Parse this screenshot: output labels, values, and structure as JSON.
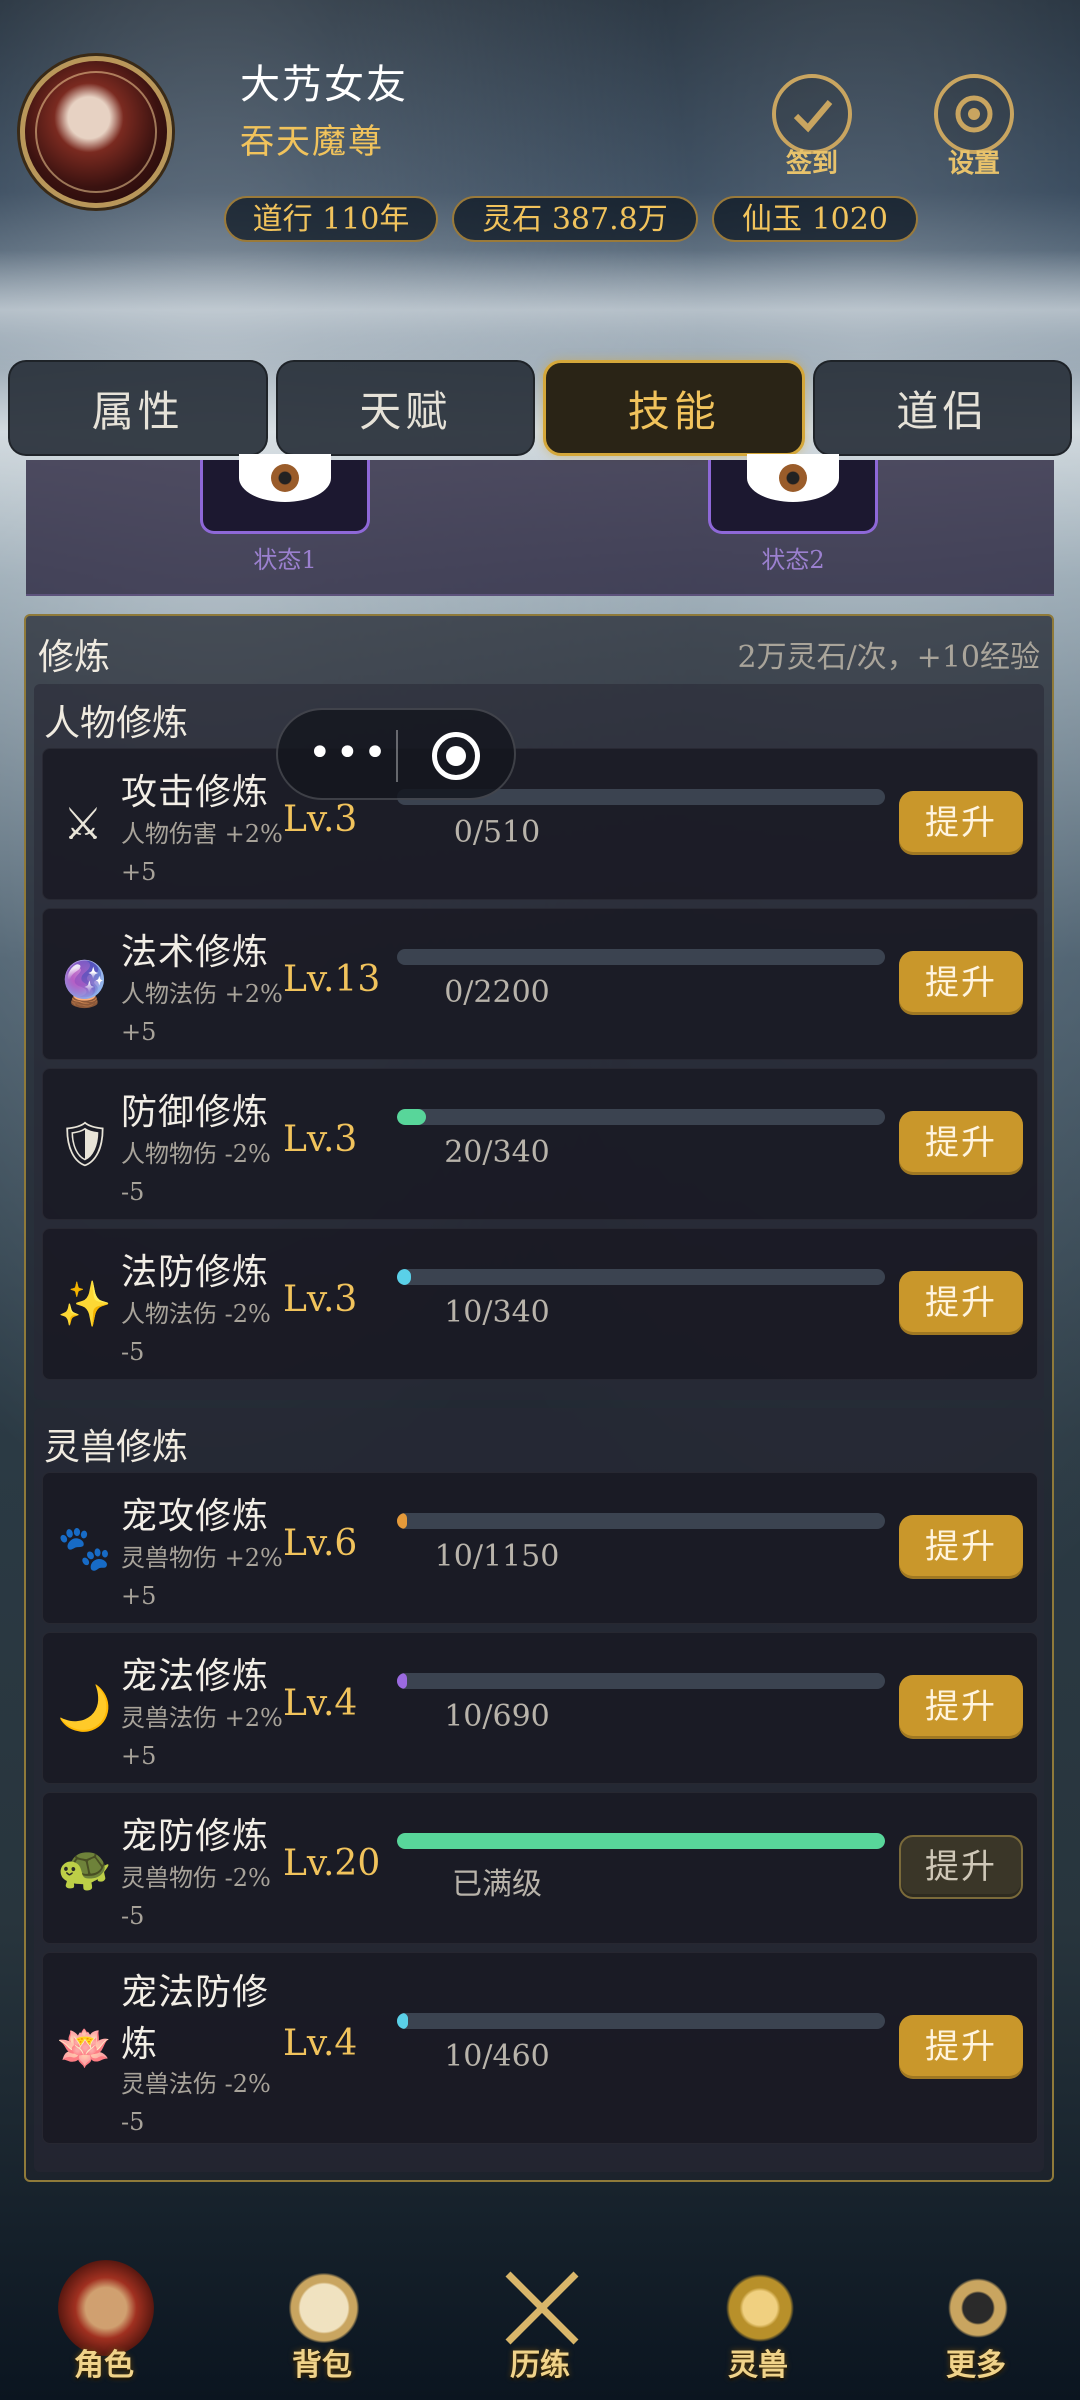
{
  "header": {
    "name": "大艿女友",
    "title": "吞天魔尊",
    "stats": [
      "道行 110年",
      "灵石 387.8万",
      "仙玉 1020"
    ],
    "checkin_label": "签到",
    "settings_label": "设置"
  },
  "tabs": [
    "属性",
    "天赋",
    "技能",
    "道侣"
  ],
  "active_tab": "技能",
  "status": {
    "items": [
      "状态1",
      "状态2"
    ]
  },
  "cultivation": {
    "title": "修炼",
    "cost": "2万灵石/次，+10经验",
    "upgrade_label": "提升",
    "character": {
      "title": "人物修炼",
      "rows": [
        {
          "name": "攻击修炼",
          "desc1": "人物伤害 +2%",
          "desc2": "+5",
          "level": "Lv.3",
          "progress": "0/510",
          "ratio": 0,
          "color": "#58d69a",
          "icon": "swords-icon",
          "glyph": "⚔"
        },
        {
          "name": "法术修炼",
          "desc1": "人物法伤 +2%",
          "desc2": "+5",
          "level": "Lv.13",
          "progress": "0/2200",
          "ratio": 0,
          "color": "#58d69a",
          "icon": "crystal-ball-icon",
          "glyph": "🔮"
        },
        {
          "name": "防御修炼",
          "desc1": "人物物伤 -2%",
          "desc2": "-5",
          "level": "Lv.3",
          "progress": "20/340",
          "ratio": 0.059,
          "color": "#58d69a",
          "icon": "shield-icon",
          "glyph": "🛡"
        },
        {
          "name": "法防修炼",
          "desc1": "人物法伤 -2%",
          "desc2": "-5",
          "level": "Lv.3",
          "progress": "10/340",
          "ratio": 0.029,
          "color": "#5ad0e8",
          "icon": "sparkles-icon",
          "glyph": "✨"
        }
      ]
    },
    "pet": {
      "title": "灵兽修炼",
      "rows": [
        {
          "name": "宠攻修炼",
          "desc1": "灵兽物伤 +2%",
          "desc2": "+5",
          "level": "Lv.6",
          "progress": "10/1150",
          "ratio": 0.009,
          "color": "#e59a3a",
          "icon": "paw-icon",
          "glyph": "🐾"
        },
        {
          "name": "宠法修炼",
          "desc1": "灵兽法伤 +2%",
          "desc2": "+5",
          "level": "Lv.4",
          "progress": "10/690",
          "ratio": 0.014,
          "color": "#9b6ae0",
          "icon": "moon-icon",
          "glyph": "🌙"
        },
        {
          "name": "宠防修炼",
          "desc1": "灵兽物伤 -2%",
          "desc2": "-5",
          "level": "Lv.20",
          "progress": "已满级",
          "ratio": 1,
          "color": "#58d69a",
          "icon": "turtle-icon",
          "glyph": "🐢",
          "maxed": true
        },
        {
          "name": "宠法防修炼",
          "desc1": "灵兽法伤 -2%",
          "desc2": "-5",
          "level": "Lv.4",
          "progress": "10/460",
          "ratio": 0.022,
          "color": "#5ad0e8",
          "icon": "lotus-icon",
          "glyph": "🪷"
        }
      ]
    }
  },
  "bottom_nav": [
    "角色",
    "背包",
    "历练",
    "灵兽",
    "更多"
  ]
}
